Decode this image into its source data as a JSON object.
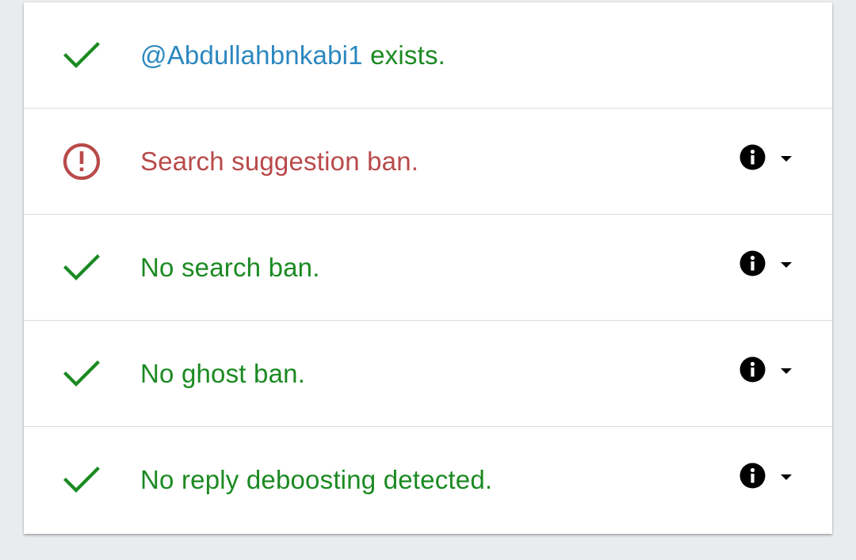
{
  "colors": {
    "success": "#1b8a22",
    "error": "#b94a4a",
    "handle": "#2b87bf",
    "page_background": "#e8ecef"
  },
  "results": [
    {
      "status": "ok",
      "icon": "check-icon",
      "handle": "@Abdullahbnkabi1",
      "text": "exists.",
      "has_details": false
    },
    {
      "status": "error",
      "icon": "alert-circle-icon",
      "text": "Search suggestion ban.",
      "has_details": true
    },
    {
      "status": "ok",
      "icon": "check-icon",
      "text": "No search ban.",
      "has_details": true
    },
    {
      "status": "ok",
      "icon": "check-icon",
      "text": "No ghost ban.",
      "has_details": true
    },
    {
      "status": "ok",
      "icon": "check-icon",
      "text": "No reply deboosting detected.",
      "has_details": true
    }
  ]
}
